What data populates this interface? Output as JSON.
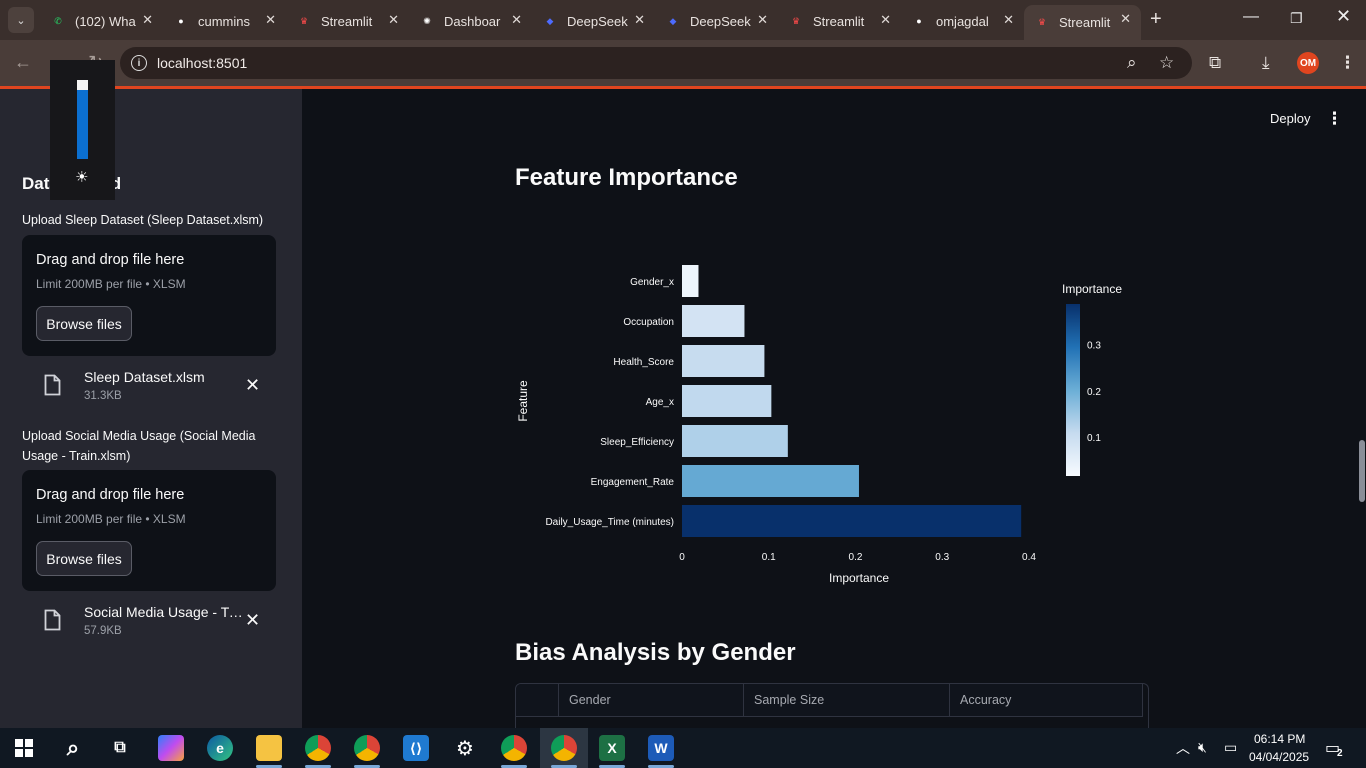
{
  "browser": {
    "tabs": [
      {
        "label": "(102) Wha",
        "icon": "whatsapp-icon",
        "color": "#25d366"
      },
      {
        "label": "cummins",
        "icon": "github-icon",
        "color": "#ffffff"
      },
      {
        "label": "Streamlit",
        "icon": "streamlit-icon",
        "color": "#ff4b4b"
      },
      {
        "label": "Dashboar",
        "icon": "openai-icon",
        "color": "#ffffff"
      },
      {
        "label": "DeepSeek",
        "icon": "deepseek-icon",
        "color": "#4d6bfe"
      },
      {
        "label": "DeepSeek",
        "icon": "deepseek-icon",
        "color": "#4d6bfe"
      },
      {
        "label": "Streamlit",
        "icon": "streamlit-icon",
        "color": "#ff4b4b"
      },
      {
        "label": "omjagdal",
        "icon": "github-icon",
        "color": "#ffffff"
      },
      {
        "label": "Streamlit",
        "icon": "streamlit-icon",
        "color": "#ff4b4b",
        "active": true
      }
    ],
    "url": "localhost:8501",
    "profile_initials": "OM"
  },
  "sidebar": {
    "title": "Data Upload",
    "uploads": [
      {
        "label": "Upload Sleep Dataset (Sleep Dataset.xlsm)",
        "dropzone_title": "Drag and drop file here",
        "dropzone_sub": "Limit 200MB per file • XLSM",
        "browse_label": "Browse files",
        "file_name": "Sleep Dataset.xlsm",
        "file_size": "31.3KB"
      },
      {
        "label": "Upload Social Media Usage (Social Media Usage - Train.xlsm)",
        "dropzone_title": "Drag and drop file here",
        "dropzone_sub": "Limit 200MB per file • XLSM",
        "browse_label": "Browse files",
        "file_name": "Social Media Usage - Train.xlsm",
        "file_size": "57.9KB"
      }
    ]
  },
  "header": {
    "deploy_label": "Deploy"
  },
  "main": {
    "feature_title": "Feature Importance",
    "bias_title": "Bias Analysis by Gender",
    "table_headers": [
      "",
      "Gender",
      "Sample Size",
      "Accuracy"
    ]
  },
  "chart_data": {
    "type": "bar",
    "orientation": "horizontal",
    "categories": [
      "Gender_x",
      "Occupation",
      "Health_Score",
      "Age_x",
      "Sleep_Efficiency",
      "Engagement_Rate",
      "Daily_Usage_Time (minutes)"
    ],
    "values": [
      0.019,
      0.072,
      0.095,
      0.103,
      0.122,
      0.204,
      0.391
    ],
    "xlabel": "Importance",
    "ylabel": "Feature",
    "xlim": [
      0,
      0.4
    ],
    "xticks": [
      "0",
      "0.1",
      "0.2",
      "0.3",
      "0.4"
    ],
    "colorbar": {
      "title": "Importance",
      "ticks": [
        "0.1",
        "0.2",
        "0.3"
      ],
      "colors": [
        "#f7fbff",
        "#c6dbef",
        "#6baed6",
        "#2171b5",
        "#08306b"
      ]
    }
  },
  "taskbar": {
    "time": "06:14 PM",
    "date": "04/04/2025",
    "notifications": "2"
  }
}
